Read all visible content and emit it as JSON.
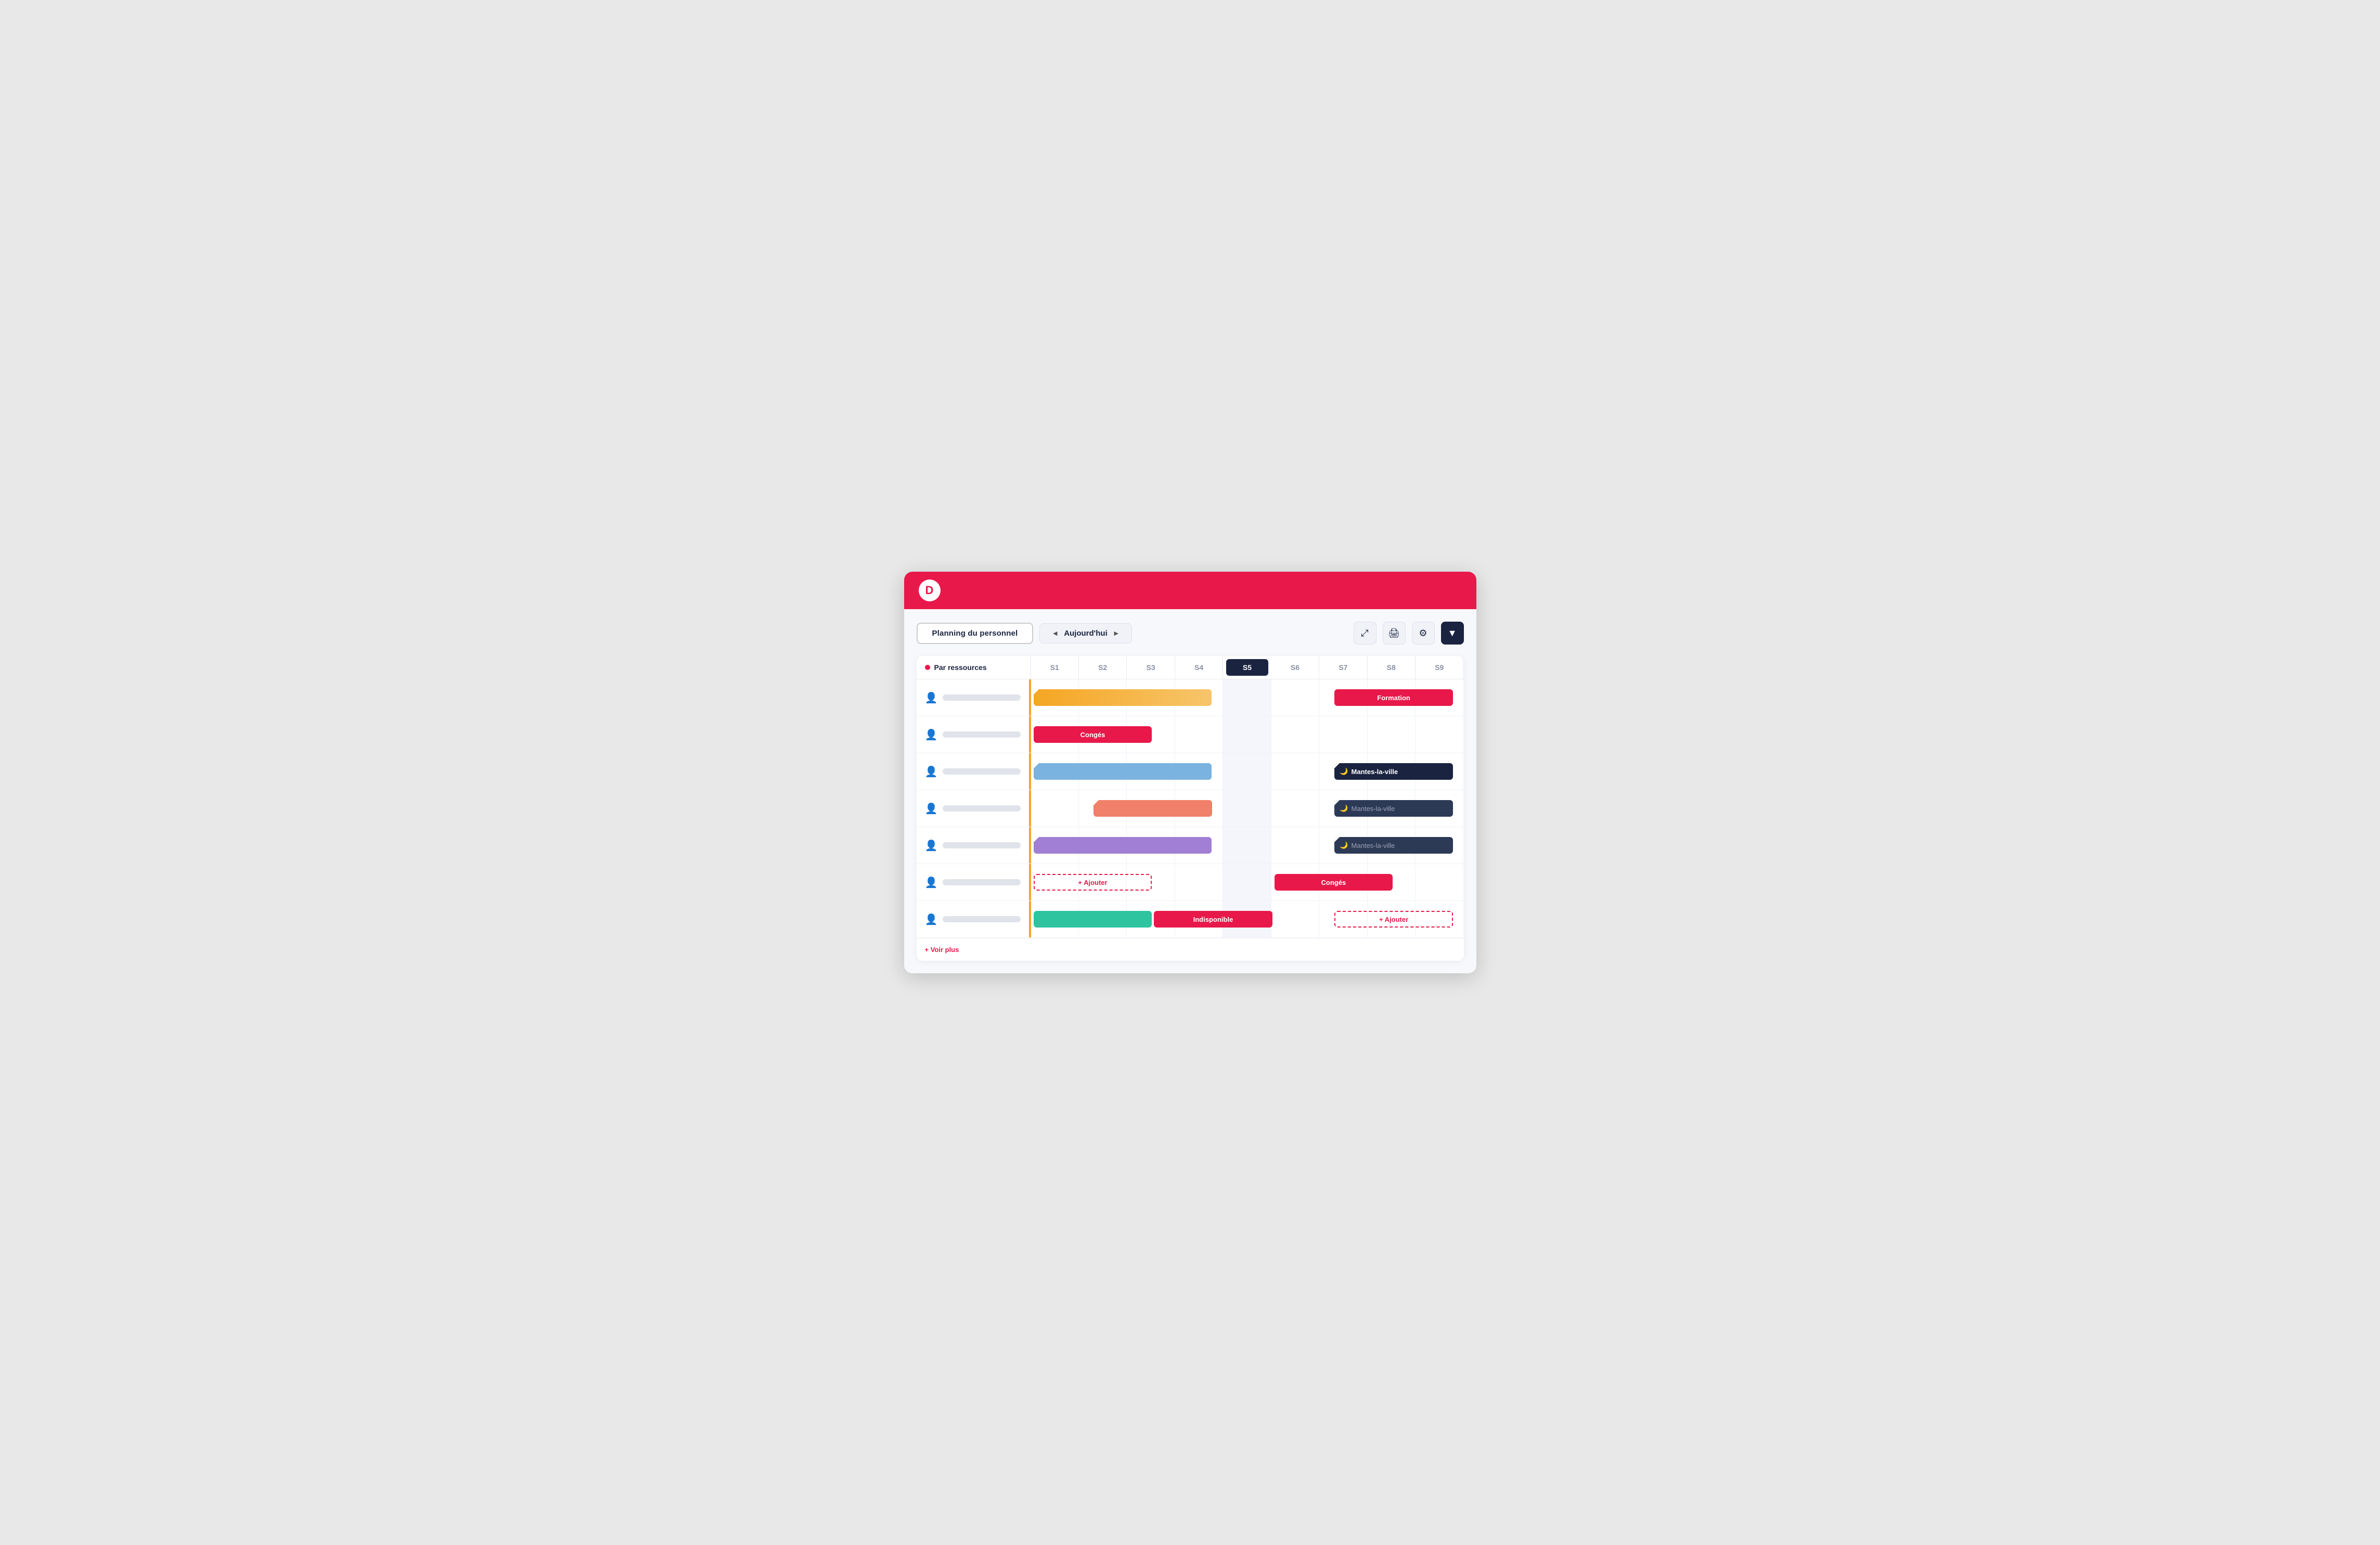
{
  "app": {
    "logo": "D",
    "logo_color": "#e8184a"
  },
  "toolbar": {
    "title_label": "Planning du personnel",
    "nav_prev": "◄",
    "nav_label": "Aujourd'hui",
    "nav_next": "►",
    "icon_expand": "⛶",
    "icon_print": "🖨",
    "icon_settings": "⚙",
    "icon_filter": "▼"
  },
  "planning": {
    "resource_header": "Par ressources",
    "weeks": [
      "S1",
      "S2",
      "S3",
      "S4",
      "S5",
      "S6",
      "S7",
      "S8",
      "S9"
    ],
    "active_week_index": 4,
    "voir_plus": "+ Voir plus",
    "rows": [
      {
        "id": "row1",
        "events": [
          {
            "label": "",
            "type": "yellow-orange",
            "col_start": 1,
            "col_span": 3,
            "has_fold": true
          },
          {
            "label": "Formation",
            "type": "formation",
            "col_start": 6,
            "col_span": 2
          }
        ]
      },
      {
        "id": "row2",
        "events": [
          {
            "label": "Congés",
            "type": "conges",
            "col_start": 1,
            "col_span": 2
          }
        ]
      },
      {
        "id": "row3",
        "events": [
          {
            "label": "",
            "type": "blue",
            "col_start": 1,
            "col_span": 3,
            "has_fold": true
          },
          {
            "label": "🌙 Mantes-la-ville",
            "type": "dark-city",
            "col_start": 6,
            "col_span": 2,
            "has_fold": true
          }
        ]
      },
      {
        "id": "row4",
        "events": [
          {
            "label": "",
            "type": "salmon",
            "col_start": 2,
            "col_span": 2,
            "has_fold": true
          },
          {
            "label": "🌙 Mantes-la-ville",
            "type": "dark-city-muted",
            "col_start": 6,
            "col_span": 2,
            "has_fold": true
          }
        ]
      },
      {
        "id": "row5",
        "events": [
          {
            "label": "",
            "type": "purple",
            "col_start": 1,
            "col_span": 3,
            "has_fold": true
          },
          {
            "label": "🌙 Mantes-la-ville",
            "type": "dark-city-muted",
            "col_start": 6,
            "col_span": 2,
            "has_fold": true
          }
        ]
      },
      {
        "id": "row6",
        "events": [
          {
            "label": "+ Ajouter",
            "type": "ajouter",
            "col_start": 1,
            "col_span": 2
          },
          {
            "label": "Congés",
            "type": "conges",
            "col_start": 5,
            "col_span": 2
          }
        ]
      },
      {
        "id": "row7",
        "events": [
          {
            "label": "",
            "type": "teal",
            "col_start": 1,
            "col_span": 2
          },
          {
            "label": "Indisponible",
            "type": "indisponible",
            "col_start": 3,
            "col_span": 2
          },
          {
            "label": "+ Ajouter",
            "type": "ajouter",
            "col_start": 6,
            "col_span": 2
          }
        ]
      }
    ]
  }
}
